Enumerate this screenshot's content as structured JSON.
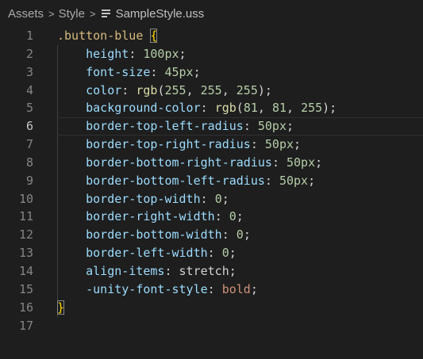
{
  "breadcrumb": {
    "items": [
      "Assets",
      "Style"
    ],
    "file_name": "SampleStyle.uss",
    "separator": ">"
  },
  "editor": {
    "current_line": 6,
    "lines": [
      {
        "n": "1",
        "tokens": [
          {
            "t": ".button-blue",
            "c": "sel"
          },
          {
            "t": " ",
            "c": "punct"
          },
          {
            "t": "{",
            "c": "brace"
          }
        ]
      },
      {
        "n": "2",
        "tokens": [
          {
            "t": "    ",
            "c": "punct"
          },
          {
            "t": "height",
            "c": "prop"
          },
          {
            "t": ": ",
            "c": "punct"
          },
          {
            "t": "100px",
            "c": "num"
          },
          {
            "t": ";",
            "c": "punct"
          }
        ]
      },
      {
        "n": "3",
        "tokens": [
          {
            "t": "    ",
            "c": "punct"
          },
          {
            "t": "font-size",
            "c": "prop"
          },
          {
            "t": ": ",
            "c": "punct"
          },
          {
            "t": "45px",
            "c": "num"
          },
          {
            "t": ";",
            "c": "punct"
          }
        ]
      },
      {
        "n": "4",
        "tokens": [
          {
            "t": "    ",
            "c": "punct"
          },
          {
            "t": "color",
            "c": "prop"
          },
          {
            "t": ": ",
            "c": "punct"
          },
          {
            "t": "rgb",
            "c": "fn"
          },
          {
            "t": "(",
            "c": "punct"
          },
          {
            "t": "255",
            "c": "num"
          },
          {
            "t": ", ",
            "c": "punct"
          },
          {
            "t": "255",
            "c": "num"
          },
          {
            "t": ", ",
            "c": "punct"
          },
          {
            "t": "255",
            "c": "num"
          },
          {
            "t": ");",
            "c": "punct"
          }
        ]
      },
      {
        "n": "5",
        "tokens": [
          {
            "t": "    ",
            "c": "punct"
          },
          {
            "t": "background-color",
            "c": "prop"
          },
          {
            "t": ": ",
            "c": "punct"
          },
          {
            "t": "rgb",
            "c": "fn"
          },
          {
            "t": "(",
            "c": "punct"
          },
          {
            "t": "81",
            "c": "num"
          },
          {
            "t": ", ",
            "c": "punct"
          },
          {
            "t": "81",
            "c": "num"
          },
          {
            "t": ", ",
            "c": "punct"
          },
          {
            "t": "255",
            "c": "num"
          },
          {
            "t": ");",
            "c": "punct"
          }
        ]
      },
      {
        "n": "6",
        "tokens": [
          {
            "t": "    ",
            "c": "punct"
          },
          {
            "t": "border-top-left-radius",
            "c": "prop"
          },
          {
            "t": ": ",
            "c": "punct"
          },
          {
            "t": "50px",
            "c": "num"
          },
          {
            "t": ";",
            "c": "punct"
          }
        ]
      },
      {
        "n": "7",
        "tokens": [
          {
            "t": "    ",
            "c": "punct"
          },
          {
            "t": "border-top-right-radius",
            "c": "prop"
          },
          {
            "t": ": ",
            "c": "punct"
          },
          {
            "t": "50px",
            "c": "num"
          },
          {
            "t": ";",
            "c": "punct"
          }
        ]
      },
      {
        "n": "8",
        "tokens": [
          {
            "t": "    ",
            "c": "punct"
          },
          {
            "t": "border-bottom-right-radius",
            "c": "prop"
          },
          {
            "t": ": ",
            "c": "punct"
          },
          {
            "t": "50px",
            "c": "num"
          },
          {
            "t": ";",
            "c": "punct"
          }
        ]
      },
      {
        "n": "9",
        "tokens": [
          {
            "t": "    ",
            "c": "punct"
          },
          {
            "t": "border-bottom-left-radius",
            "c": "prop"
          },
          {
            "t": ": ",
            "c": "punct"
          },
          {
            "t": "50px",
            "c": "num"
          },
          {
            "t": ";",
            "c": "punct"
          }
        ]
      },
      {
        "n": "10",
        "tokens": [
          {
            "t": "    ",
            "c": "punct"
          },
          {
            "t": "border-top-width",
            "c": "prop"
          },
          {
            "t": ": ",
            "c": "punct"
          },
          {
            "t": "0",
            "c": "num"
          },
          {
            "t": ";",
            "c": "punct"
          }
        ]
      },
      {
        "n": "11",
        "tokens": [
          {
            "t": "    ",
            "c": "punct"
          },
          {
            "t": "border-right-width",
            "c": "prop"
          },
          {
            "t": ": ",
            "c": "punct"
          },
          {
            "t": "0",
            "c": "num"
          },
          {
            "t": ";",
            "c": "punct"
          }
        ]
      },
      {
        "n": "12",
        "tokens": [
          {
            "t": "    ",
            "c": "punct"
          },
          {
            "t": "border-bottom-width",
            "c": "prop"
          },
          {
            "t": ": ",
            "c": "punct"
          },
          {
            "t": "0",
            "c": "num"
          },
          {
            "t": ";",
            "c": "punct"
          }
        ]
      },
      {
        "n": "13",
        "tokens": [
          {
            "t": "    ",
            "c": "punct"
          },
          {
            "t": "border-left-width",
            "c": "prop"
          },
          {
            "t": ": ",
            "c": "punct"
          },
          {
            "t": "0",
            "c": "num"
          },
          {
            "t": ";",
            "c": "punct"
          }
        ]
      },
      {
        "n": "14",
        "tokens": [
          {
            "t": "    ",
            "c": "punct"
          },
          {
            "t": "align-items",
            "c": "prop"
          },
          {
            "t": ": ",
            "c": "punct"
          },
          {
            "t": "stretch",
            "c": "punct"
          },
          {
            "t": ";",
            "c": "punct"
          }
        ]
      },
      {
        "n": "15",
        "tokens": [
          {
            "t": "    ",
            "c": "punct"
          },
          {
            "t": "-unity-font-style",
            "c": "prop"
          },
          {
            "t": ": ",
            "c": "punct"
          },
          {
            "t": "bold",
            "c": "kw"
          },
          {
            "t": ";",
            "c": "punct"
          }
        ]
      },
      {
        "n": "16",
        "tokens": [
          {
            "t": "}",
            "c": "brace"
          }
        ]
      },
      {
        "n": "17",
        "tokens": []
      }
    ]
  },
  "colors": {
    "background": "#1e1e1e",
    "selector": "#d7ba7d",
    "property": "#9cdcfe",
    "number": "#b5cea8",
    "function": "#dcdcaa",
    "keyword_value": "#ce9178",
    "brace": "#ffd700"
  }
}
